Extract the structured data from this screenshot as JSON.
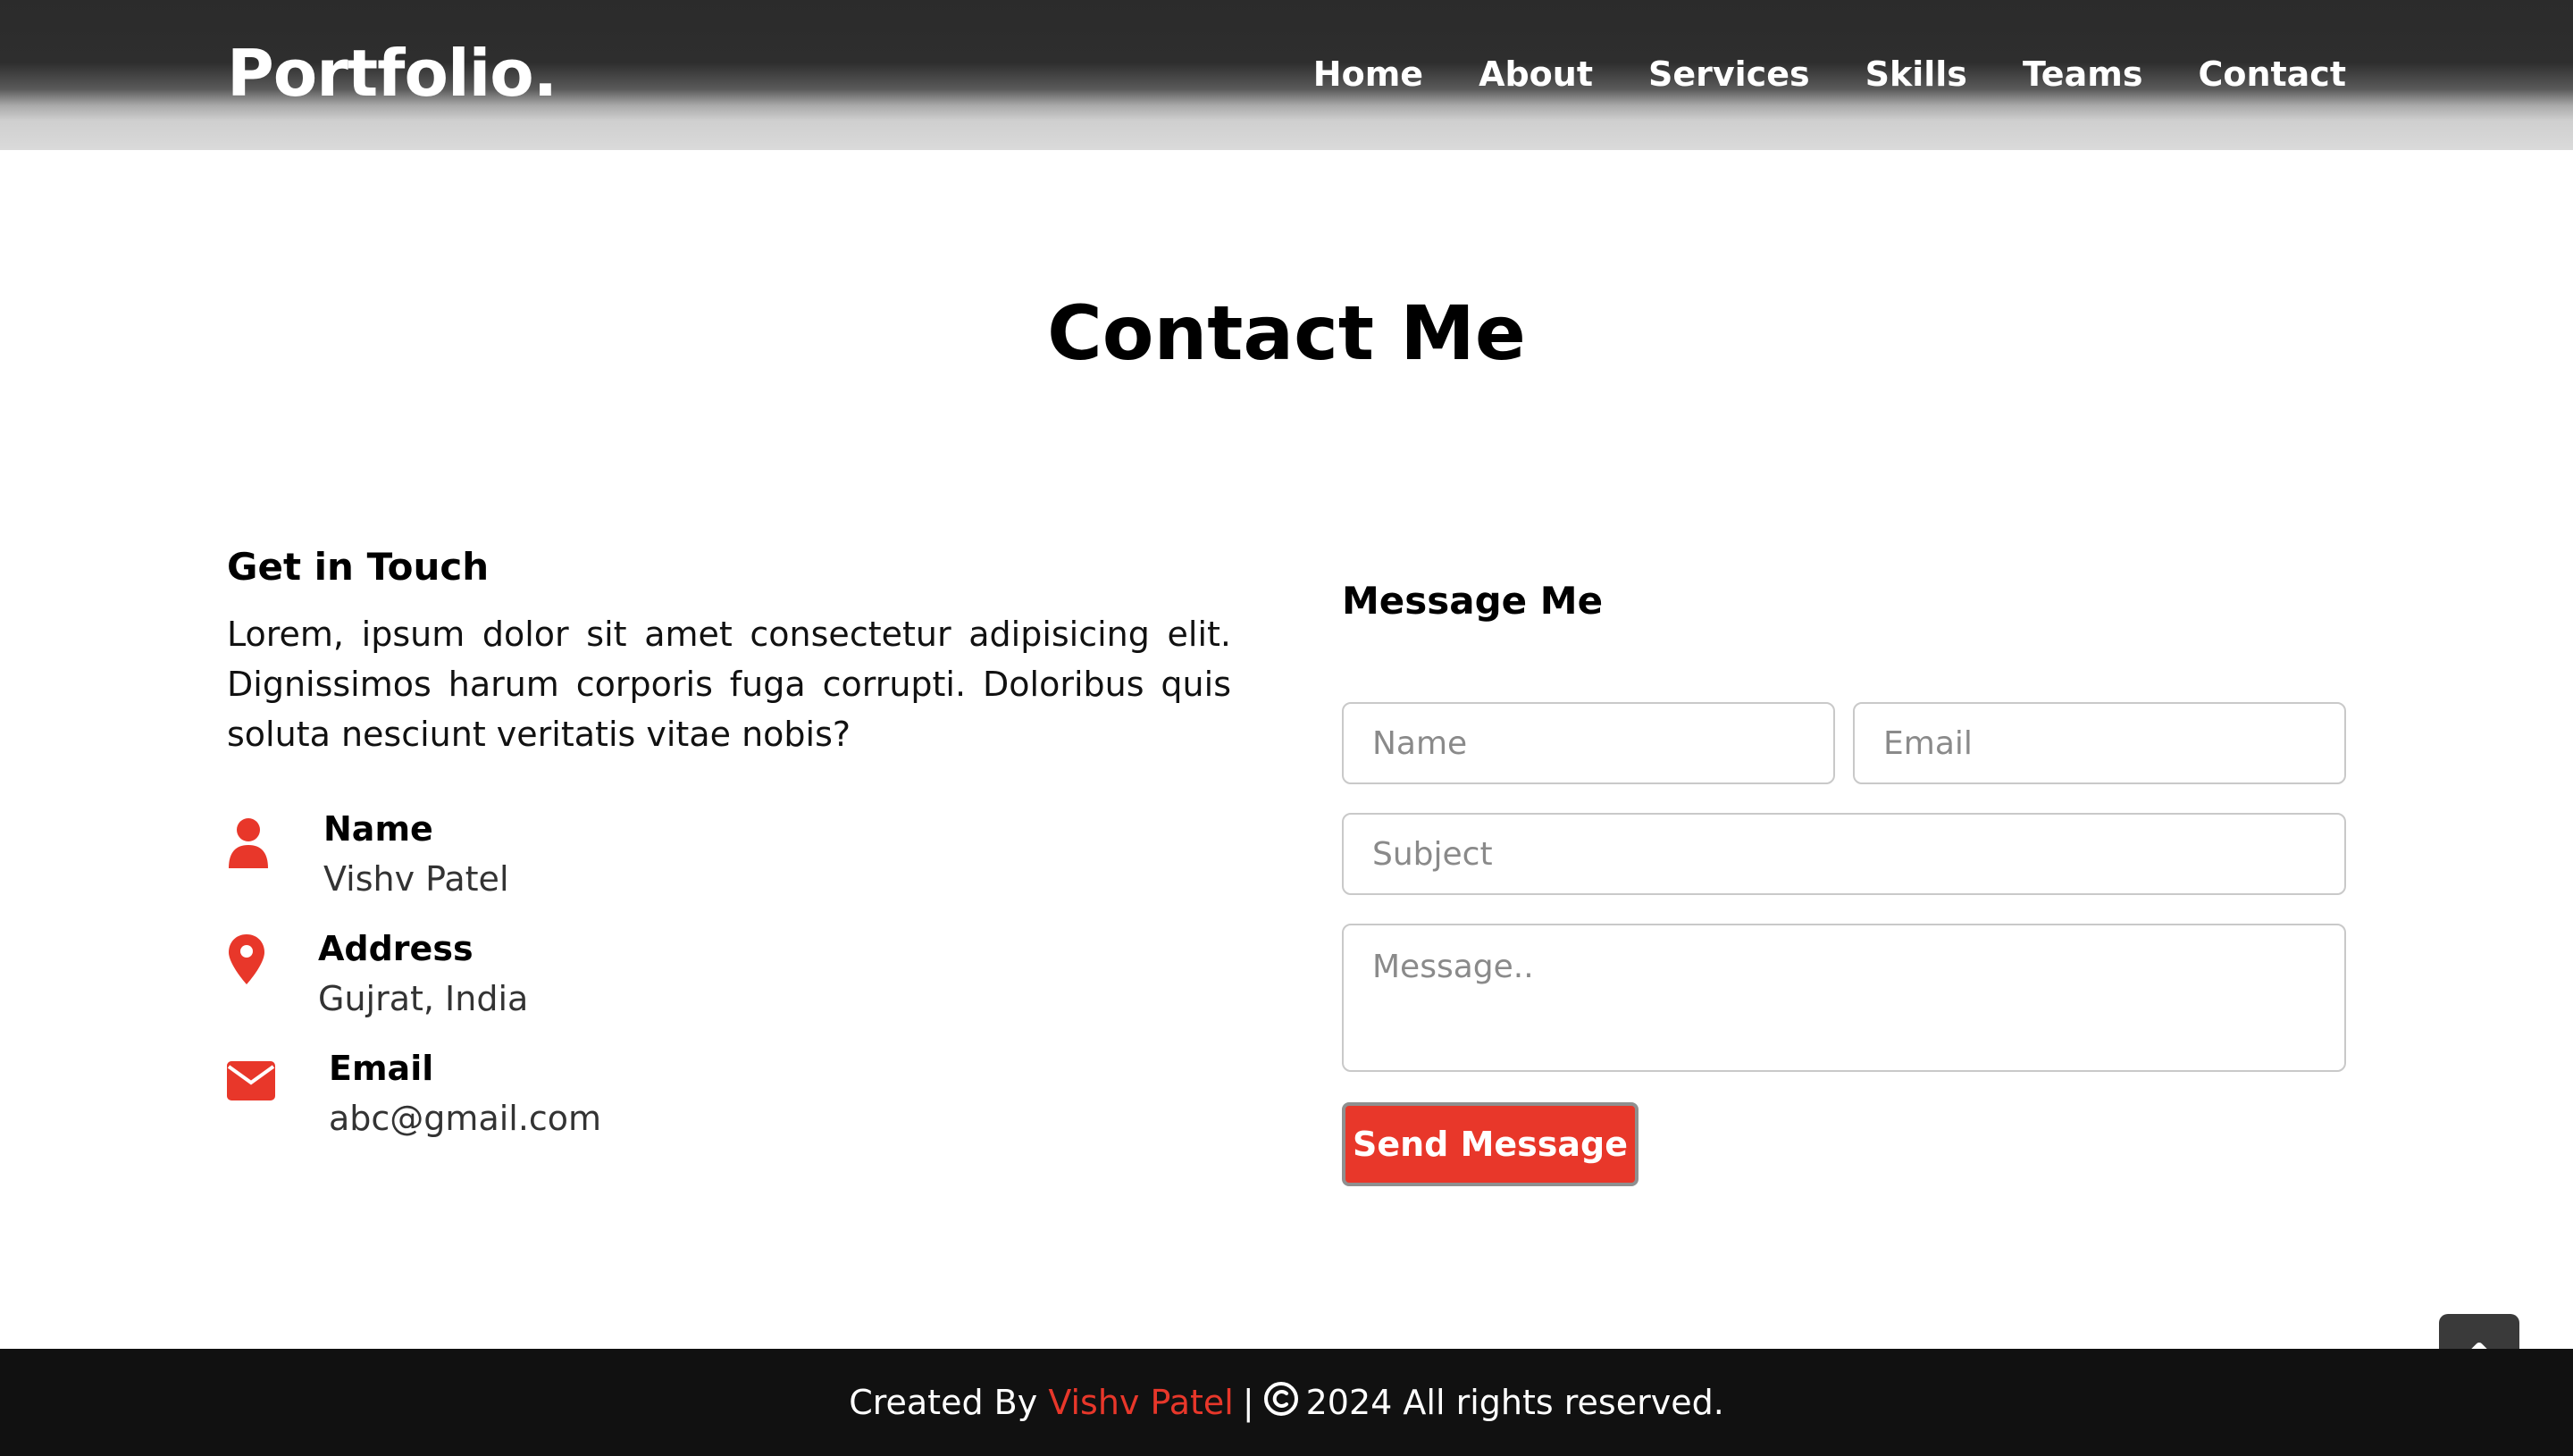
{
  "navbar": {
    "logo": "Portfolio.",
    "items": [
      {
        "label": "Home"
      },
      {
        "label": "About"
      },
      {
        "label": "Services"
      },
      {
        "label": "Skills"
      },
      {
        "label": "Teams"
      },
      {
        "label": "Contact"
      }
    ]
  },
  "contact": {
    "title": "Contact Me",
    "left": {
      "heading": "Get in Touch",
      "intro": "Lorem, ipsum dolor sit amet consectetur adipisicing elit. Dignissimos harum corporis fuga corrupti. Doloribus quis soluta nesciunt veritatis vitae nobis?",
      "info": [
        {
          "icon": "user-icon",
          "head": "Name",
          "sub": "Vishv Patel"
        },
        {
          "icon": "map-marker-icon",
          "head": "Address",
          "sub": "Gujrat, India"
        },
        {
          "icon": "envelope-icon",
          "head": "Email",
          "sub": "abc@gmail.com"
        }
      ]
    },
    "form": {
      "heading": "Message Me",
      "name_placeholder": "Name",
      "email_placeholder": "Email",
      "subject_placeholder": "Subject",
      "message_placeholder": "Message..",
      "submit_label": "Send Message"
    }
  },
  "footer": {
    "created_by": "Created By",
    "author": "Vishv Patel",
    "separator": "|",
    "rights": "2024 All rights reserved."
  },
  "colors": {
    "accent": "#e8372a",
    "footer_bg": "#111111",
    "scroll_button_bg": "#3a3a3a"
  },
  "icons": {
    "scroll_top": "chevron-up-icon",
    "copyright": "copyright-icon"
  }
}
